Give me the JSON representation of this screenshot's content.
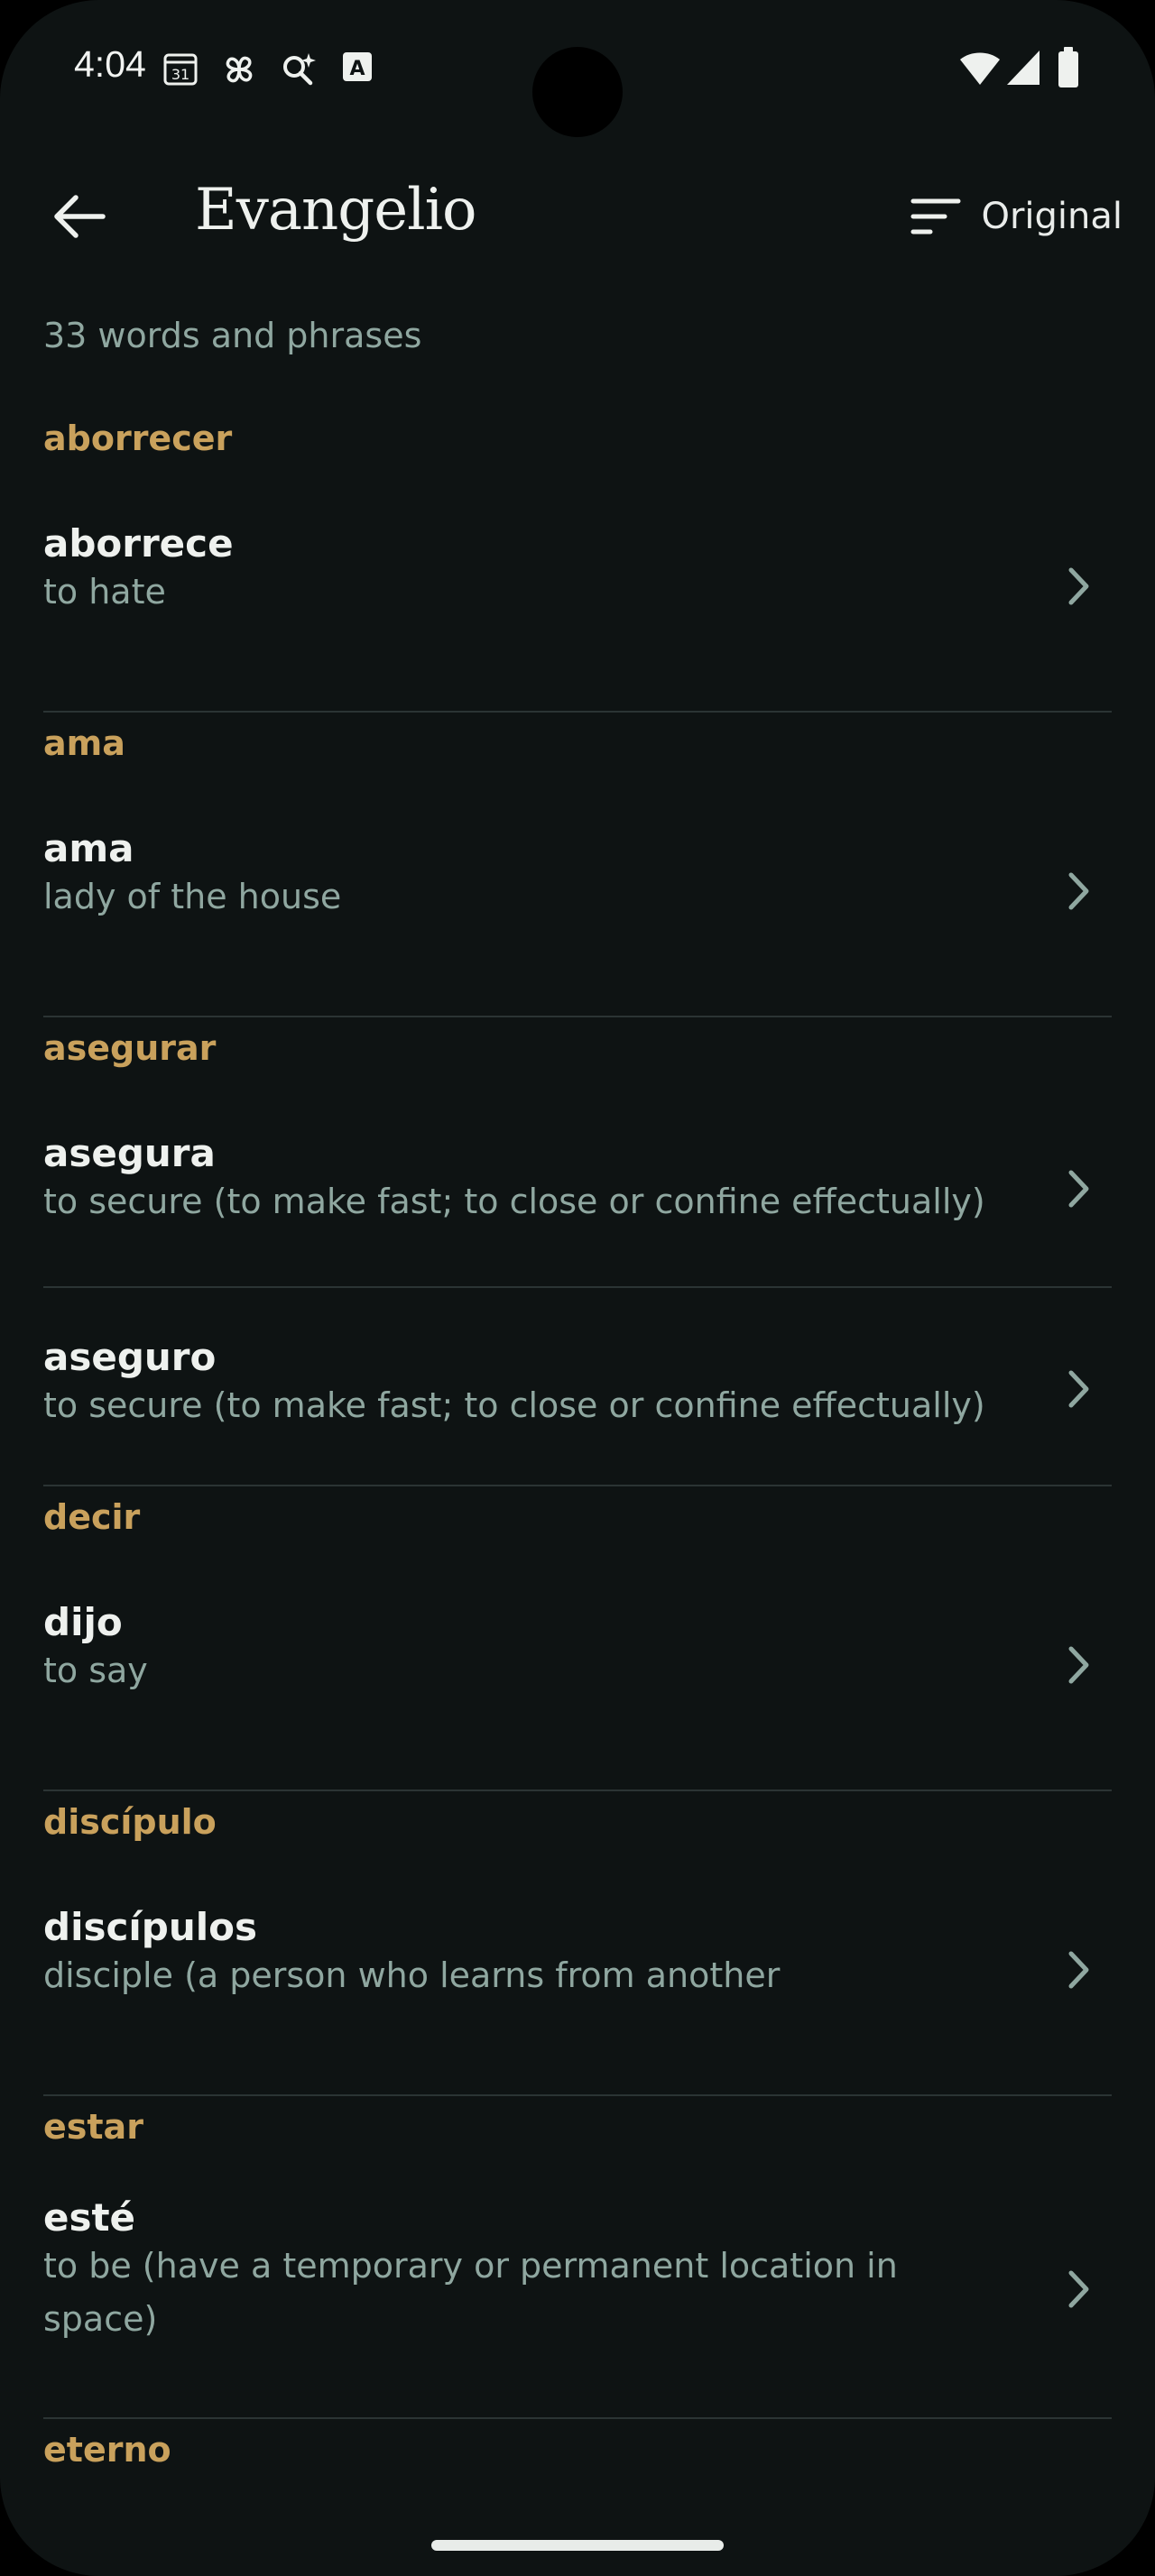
{
  "status_bar": {
    "time": "4:04"
  },
  "app_bar": {
    "title": "Evangelio",
    "sort_label": "Original"
  },
  "word_count": "33 words and phrases",
  "groups": [
    {
      "lemma": "aborrecer",
      "entries": [
        {
          "word": "aborrece",
          "definition": "to hate"
        }
      ]
    },
    {
      "lemma": "ama",
      "entries": [
        {
          "word": "ama",
          "definition": "lady of the house"
        }
      ]
    },
    {
      "lemma": "asegurar",
      "entries": [
        {
          "word": "asegura",
          "definition": "to secure (to make fast; to close or confine effectually)"
        },
        {
          "word": "aseguro",
          "definition": "to secure (to make fast; to close or confine effectually)"
        }
      ]
    },
    {
      "lemma": "decir",
      "entries": [
        {
          "word": "dijo",
          "definition": "to say"
        }
      ]
    },
    {
      "lemma": "discípulo",
      "entries": [
        {
          "word": "discípulos",
          "definition": "disciple (a person who learns from another"
        }
      ]
    },
    {
      "lemma": "estar",
      "entries": [
        {
          "word": "esté",
          "definition": "to be (have a temporary or permanent location in space)"
        }
      ]
    },
    {
      "lemma": "eterno",
      "entries": []
    }
  ],
  "colors": {
    "background": "#0e1313",
    "lemma": "#c9a15c",
    "secondary_text": "#8fa7a0",
    "divider": "#2b3434"
  }
}
